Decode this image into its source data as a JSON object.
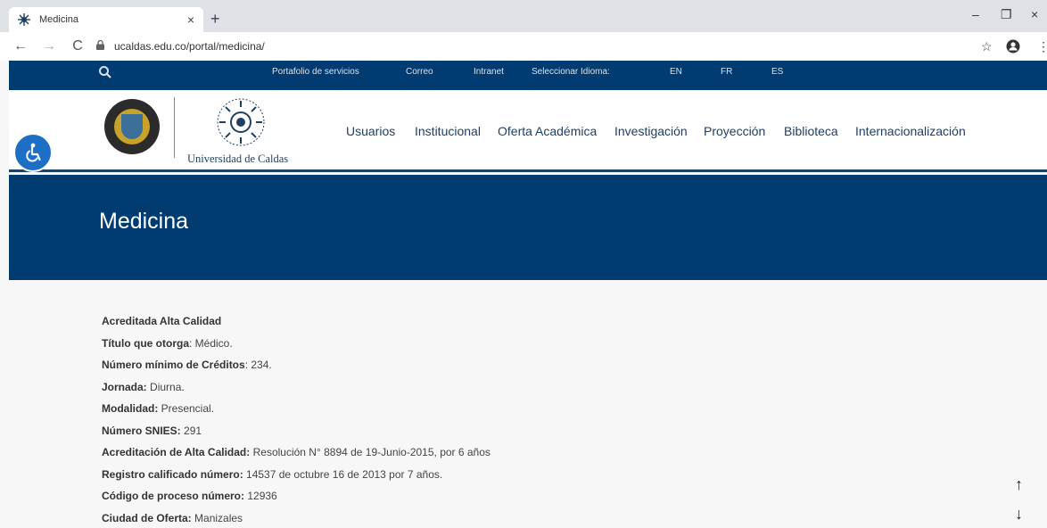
{
  "browser": {
    "tab_title": "Medicina",
    "tab_close": "×",
    "new_tab": "+",
    "url": "ucaldas.edu.co/portal/medicina/",
    "back": "←",
    "forward": "→",
    "reload": "C",
    "minimize": "–",
    "restore": "❐",
    "close": "×",
    "star": "☆",
    "menu": "⋮",
    "favicon_color": "#1e3f66"
  },
  "topbar": {
    "portfolio": "Portafolio de servicios",
    "mail": "Correo",
    "intranet": "Intranet",
    "language_label": "Seleccionar Idioma:",
    "lang_en": "EN",
    "lang_fr": "FR",
    "lang_es": "ES",
    "bg_color": "#003b71"
  },
  "header": {
    "university_name": "Universidad de Caldas",
    "nav": [
      "Usuarios",
      "Institucional",
      "Oferta Académica",
      "Investigación",
      "Proyección",
      "Biblioteca",
      "Internacionalización"
    ]
  },
  "banner": {
    "title": "Medicina"
  },
  "content": {
    "lines": [
      {
        "label": "Acreditada Alta Calidad",
        "value": ""
      },
      {
        "label": "Título que otorga",
        "value": ": Médico."
      },
      {
        "label": "Número mínimo de Créditos",
        "value": ": 234."
      },
      {
        "label": "Jornada:",
        "value": " Diurna."
      },
      {
        "label": "Modalidad:",
        "value": " Presencial."
      },
      {
        "label": "Número SNIES:",
        "value": " 291"
      },
      {
        "label": "Acreditación de Alta Calidad:",
        "value": " Resolución N° 8894 de 19-Junio-2015, por 6 años"
      },
      {
        "label": "Registro calificado número:",
        "value": " 14537 de octubre 16 de 2013 por 7 años."
      },
      {
        "label": "Código de proceso número:",
        "value": " 12936"
      },
      {
        "label": "Ciudad de Oferta:",
        "value": " Manizales"
      }
    ]
  },
  "scroll": {
    "up": "↑",
    "down": "↓"
  }
}
